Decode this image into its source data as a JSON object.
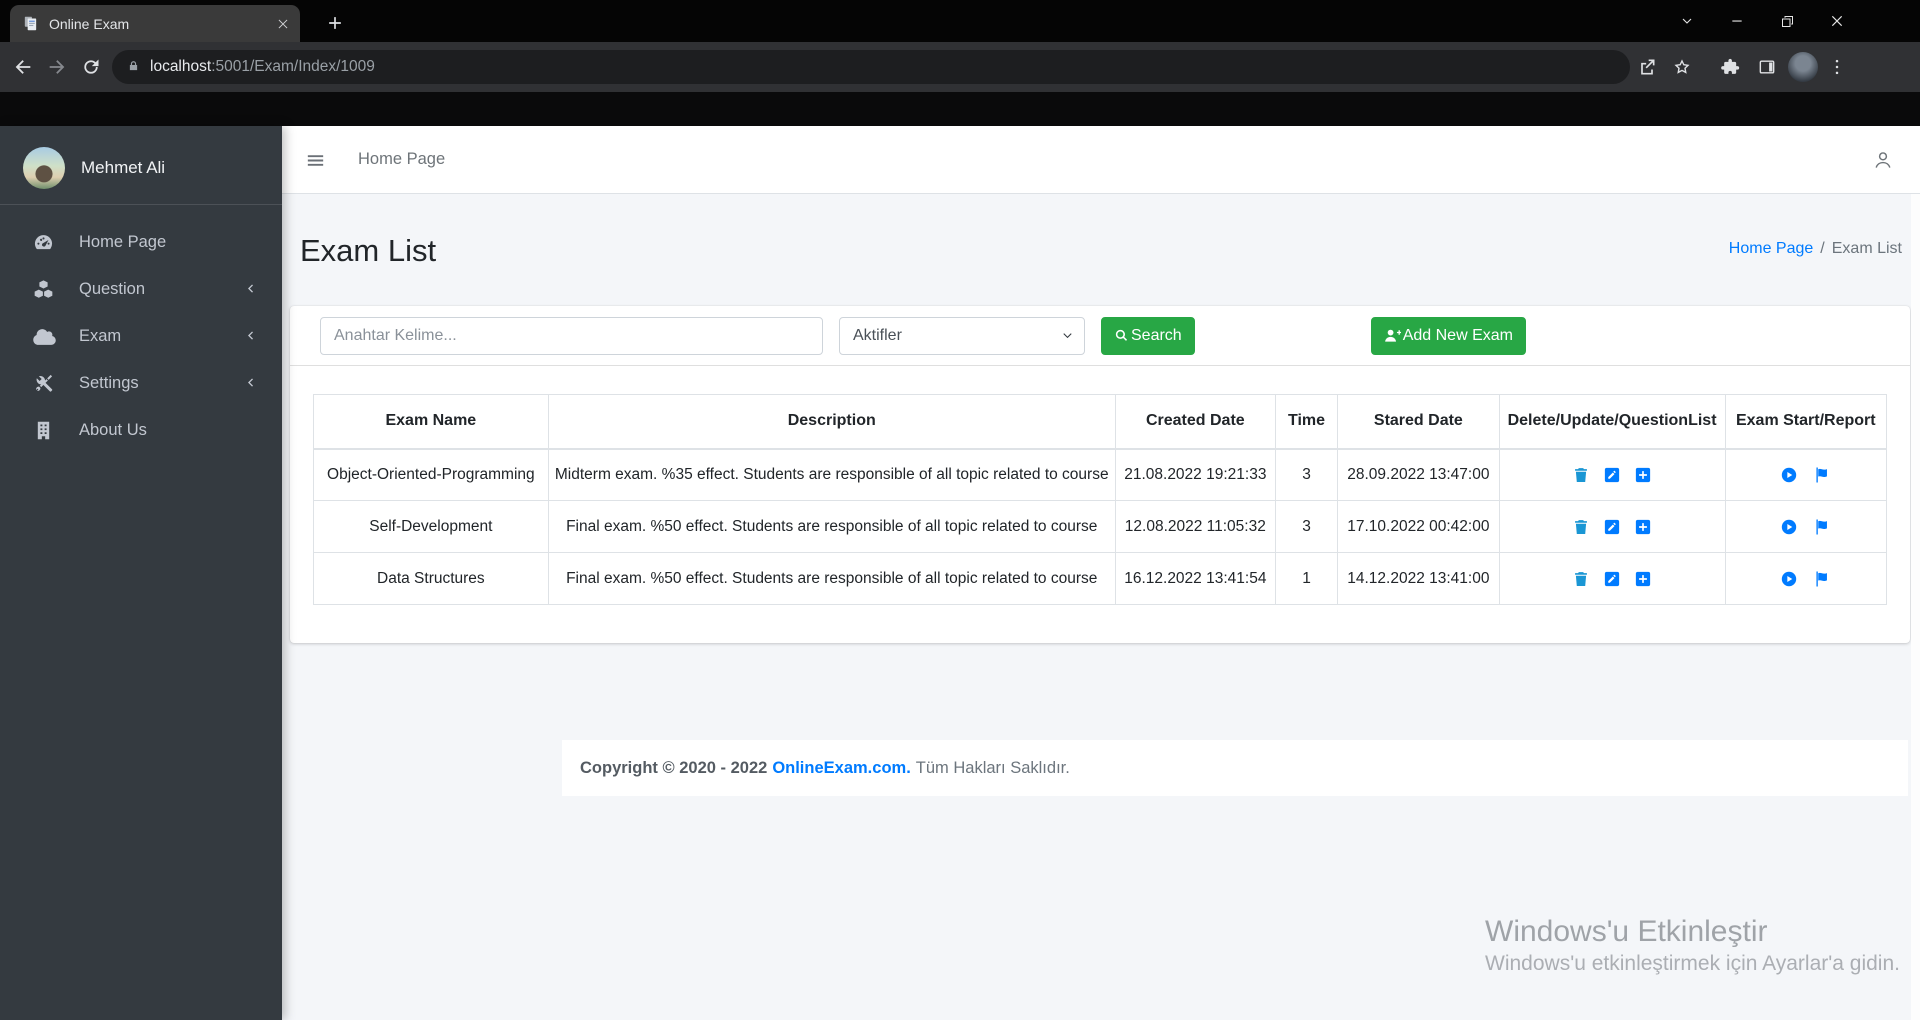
{
  "browser": {
    "tab_title": "Online Exam",
    "url_host": "localhost",
    "url_path": ":5001/Exam/Index/1009"
  },
  "sidebar": {
    "user_name": "Mehmet Ali",
    "items": [
      {
        "label": "Home Page"
      },
      {
        "label": "Question"
      },
      {
        "label": "Exam"
      },
      {
        "label": "Settings"
      },
      {
        "label": "About Us"
      }
    ]
  },
  "navbar": {
    "home_link": "Home Page"
  },
  "page": {
    "title": "Exam List",
    "breadcrumb_home": "Home Page",
    "breadcrumb_separator": "/",
    "breadcrumb_current": "Exam List"
  },
  "filters": {
    "keyword_placeholder": "Anahtar Kelime...",
    "status_selected": "Aktifler",
    "search_label": "Search",
    "add_new_exam_label": "Add New Exam"
  },
  "table": {
    "headers": [
      "Exam Name",
      "Description",
      "Created Date",
      "Time",
      "Stared Date",
      "Delete/Update/QuestionList",
      "Exam Start/Report"
    ],
    "rows": [
      {
        "exam_name": "Object-Oriented-Programming",
        "description": "Midterm exam. %35 effect. Students are responsible of all topic related to course",
        "created_date": "21.08.2022 19:21:33",
        "time": "3",
        "stared_date": "28.09.2022 13:47:00"
      },
      {
        "exam_name": "Self-Development",
        "description": "Final exam. %50 effect. Students are responsible of all topic related to course",
        "created_date": "12.08.2022 11:05:32",
        "time": "3",
        "stared_date": "17.10.2022 00:42:00"
      },
      {
        "exam_name": "Data Structures",
        "description": "Final exam. %50 effect. Students are responsible of all topic related to course",
        "created_date": "16.12.2022 13:41:54",
        "time": "1",
        "stared_date": "14.12.2022 13:41:00"
      }
    ]
  },
  "footer": {
    "copyright": "Copyright © 2020 - 2022",
    "brand": "OnlineExam.com.",
    "rights": "Tüm Hakları Saklıdır."
  },
  "watermark": {
    "line1": "Windows'u Etkinleştir",
    "line2": "Windows'u etkinleştirmek için Ayarlar'a gidin."
  },
  "colors": {
    "accent_green": "#28a745",
    "accent_blue": "#007bff",
    "sidebar_bg": "#343a40",
    "content_bg": "#f4f6f9"
  }
}
